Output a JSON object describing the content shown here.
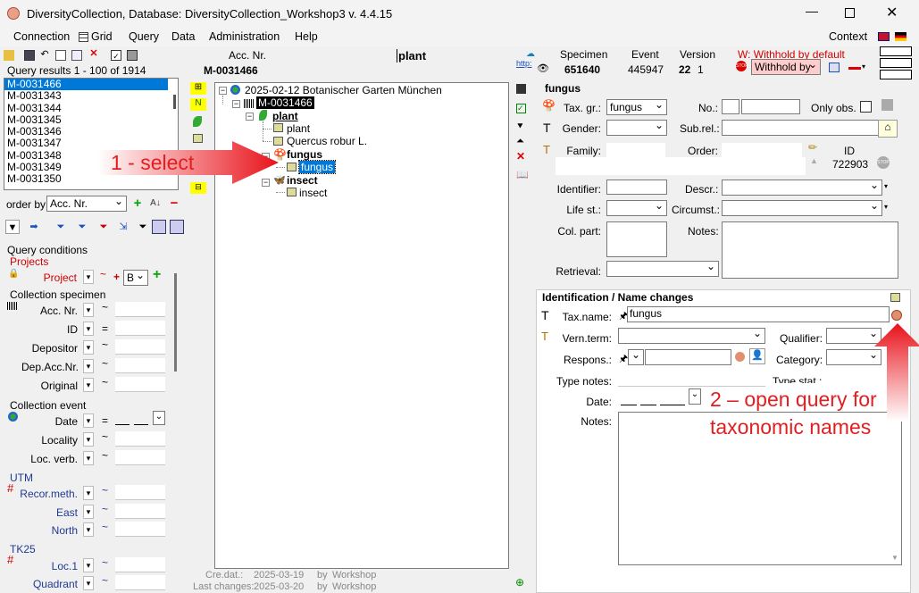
{
  "window": {
    "title": "DiversityCollection,  Database: DiversityCollection_Workshop3    v. 4.4.15"
  },
  "menu": [
    "Connection",
    "Grid",
    "Query",
    "Data",
    "Administration",
    "Help"
  ],
  "context_label": "Context",
  "header": {
    "acc_nr_label": "Acc. Nr.",
    "acc_nr_value": "M-0031466",
    "title_value": "plant",
    "http_label": "http:",
    "specimen_label": "Specimen",
    "specimen_value": "651640",
    "event_label": "Event",
    "event_value": "445947",
    "version_label": "Version",
    "version_value": "22",
    "version_sub": "1",
    "withhold_label": "W: Withhold by default",
    "withhold_value": "Withhold by"
  },
  "query_results": {
    "label": "Query results   1 - 100 of 1914",
    "items": [
      "M-0031466",
      "M-0031343",
      "M-0031344",
      "M-0031345",
      "M-0031346",
      "M-0031347",
      "M-0031348",
      "M-0031349",
      "M-0031350"
    ]
  },
  "order_by": {
    "label": "order by:",
    "value": "Acc. Nr."
  },
  "query_conditions": {
    "label": "Query conditions",
    "projects": {
      "header": "Projects",
      "project_label": "Project",
      "project_value": "B"
    },
    "collection_specimen": {
      "header": "Collection specimen",
      "fields": [
        "Acc. Nr.",
        "ID",
        "Depositor",
        "Dep.Acc.Nr.",
        "Original"
      ]
    },
    "collection_event": {
      "header": "Collection event",
      "fields": [
        "Date",
        "Locality",
        "Loc. verb."
      ]
    },
    "utm": {
      "header": "UTM",
      "fields": [
        "Recor.meth.",
        "East",
        "North"
      ]
    },
    "tk25": {
      "header": "TK25",
      "fields": [
        "Loc.1",
        "Quadrant"
      ]
    }
  },
  "tree": {
    "event": "2025-02-12 Botanischer Garten München",
    "specimen": "M-0031466",
    "plant_unit": "plant",
    "plant_id1": "plant",
    "plant_id2": "Quercus robur L.",
    "fungus_unit": "fungus",
    "fungus_id": "fungus",
    "insect_unit": "insect",
    "insect_id": "insect"
  },
  "footer": {
    "cre_dat_label": "Cre.dat.:",
    "cre_dat_value": "2025-03-19",
    "cre_by_label": "by",
    "cre_by_value": "Workshop",
    "last_label": "Last changes:",
    "last_value": "2025-03-20",
    "last_by_label": "by",
    "last_by_value": "Workshop"
  },
  "unit": {
    "header": "fungus",
    "tax_gr_label": "Tax. gr.:",
    "tax_gr_value": "fungus",
    "no_label": "No.:",
    "only_obs_label": "Only obs.",
    "gender_label": "Gender:",
    "sub_rel_label": "Sub.rel.:",
    "family_label": "Family:",
    "order_label": "Order:",
    "id_label": "ID",
    "id_value": "722903",
    "identifier_label": "Identifier:",
    "descr_label": "Descr.:",
    "life_st_label": "Life st.:",
    "circumst_label": "Circumst.:",
    "col_part_label": "Col. part:",
    "notes_label": "Notes:",
    "retrieval_label": "Retrieval:"
  },
  "identification": {
    "header": "Identification / Name changes",
    "tax_name_label": "Tax.name:",
    "tax_name_value": "fungus",
    "vern_term_label": "Vern.term:",
    "qualifier_label": "Qualifier:",
    "respons_label": "Respons.:",
    "category_label": "Category:",
    "type_notes_label": "Type notes:",
    "type_stat_label": "Type stat.:",
    "date_label": "Date:",
    "notes_label": "Notes:"
  },
  "annotations": {
    "step1": "1 - select",
    "step2_line1": "2 – open query for",
    "step2_line2": "taxonomic names"
  },
  "colors": {
    "selection": "#0078d7",
    "annotation_red": "#e02020",
    "highlight_yellow": "#ffff00"
  }
}
